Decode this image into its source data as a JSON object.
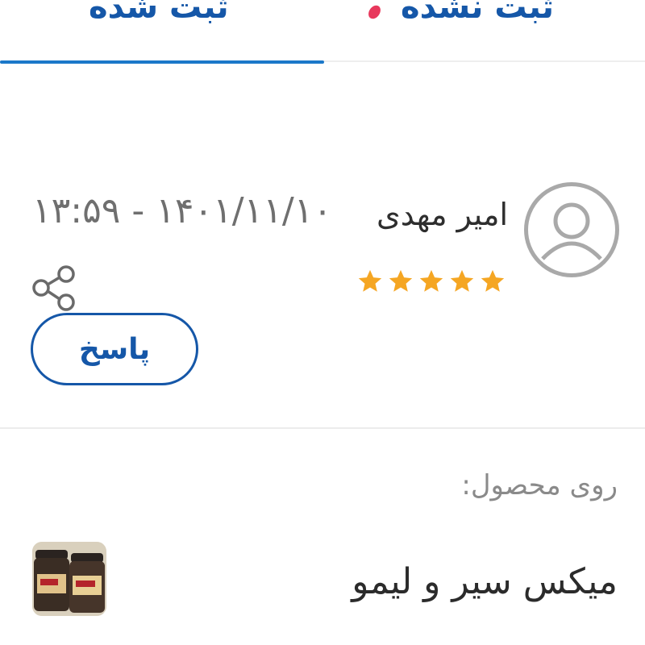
{
  "tabs": {
    "registered_label": "ثبت شده",
    "unregistered_label": "ثبت نشده",
    "active": "registered",
    "accent_color": "#1b78c9",
    "badge_color": "#e8385c"
  },
  "review": {
    "user_name": "امیر مهدی",
    "avatar_icon": "user-circle-icon",
    "rating": 5,
    "rating_max": 5,
    "date_time": "۱۳:۵۹ - ۱۴۰۱/۱۱/۱۰",
    "share_icon": "share-icon",
    "reply_label": "پاسخ",
    "star_color": "#f5a623"
  },
  "product": {
    "on_product_label": "روی محصول:",
    "name": "میکس سیر و لیمو"
  }
}
